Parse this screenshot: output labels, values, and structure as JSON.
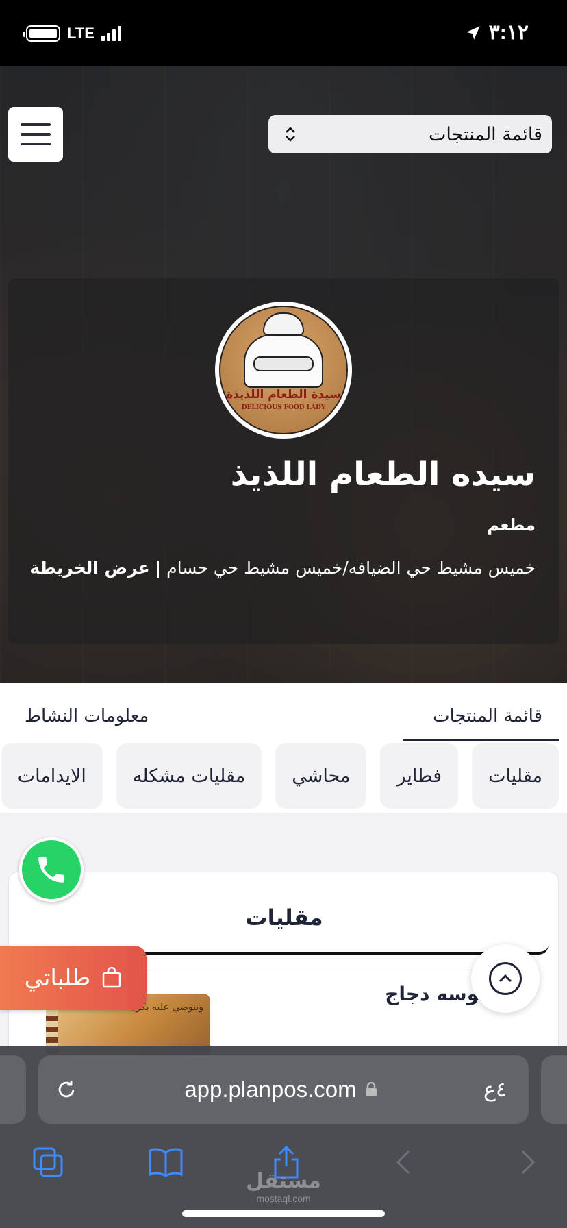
{
  "status_bar": {
    "time": "٣:١٢",
    "network": "LTE"
  },
  "header": {
    "select_value": "قائمة المنتجات"
  },
  "restaurant": {
    "logo_text_ar": "سيدة الطعام اللذيذة",
    "logo_text_en": "DELICIOUS FOOD LADY",
    "name": "سيده الطعام اللذيذ",
    "type": "مطعم",
    "address": "خميس مشيط حي الضيافه/خميس مشيط حي حسام | ",
    "map_link": "عرض الخريطة"
  },
  "tabs": [
    {
      "label": "قائمة المنتجات"
    },
    {
      "label": "معلومات النشاط"
    }
  ],
  "categories": [
    "مقليات",
    "فطاير",
    "محاشي",
    "مقليات مشكله",
    "الايدامات"
  ],
  "section": {
    "title": "مقليات"
  },
  "product": {
    "name": "سمبوسه دجاج",
    "image_text": "وبنوصي عليه بكرة"
  },
  "floating": {
    "orders_label": "طلباتي"
  },
  "browser": {
    "url": "app.planpos.com",
    "aa": "٤ع"
  },
  "watermark": {
    "ar": "مستقل",
    "en": "mostaql.com"
  },
  "colors": {
    "primary": "#1f2436",
    "whatsapp": "#25d366",
    "orders_start": "#f07a50",
    "orders_end": "#e2544a"
  }
}
